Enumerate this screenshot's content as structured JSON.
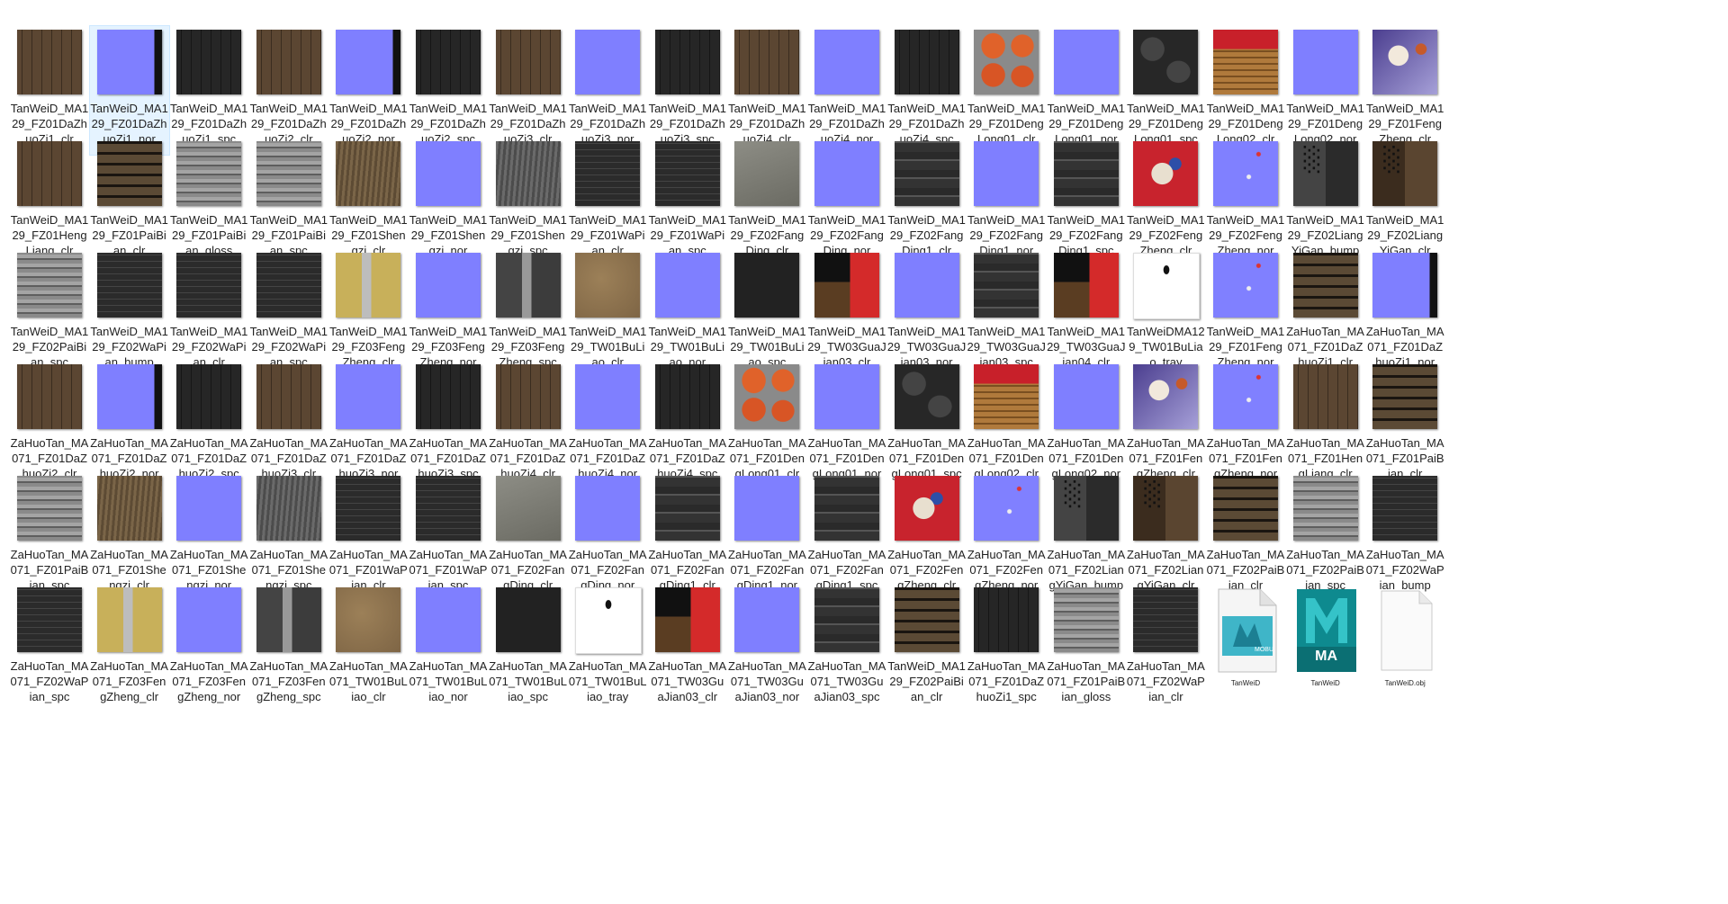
{
  "file_view": {
    "selected_index": 1,
    "accent_color": "#e5f3ff",
    "items": [
      {
        "name": "TanWeiD_MA129_FZ01DaZhuoZi1_clr",
        "thumb": "wood-brown",
        "icon": "texture-thumbnail"
      },
      {
        "name": "TanWeiD_MA129_FZ01DaZhuoZi1_nor",
        "thumb": "normal-panels",
        "icon": "texture-thumbnail"
      },
      {
        "name": "TanWeiD_MA129_FZ01DaZhuoZi1_spc",
        "thumb": "dark-wood",
        "icon": "texture-thumbnail"
      },
      {
        "name": "TanWeiD_MA129_FZ01DaZhuoZi2_clr",
        "thumb": "wood-brown",
        "icon": "texture-thumbnail"
      },
      {
        "name": "TanWeiD_MA129_FZ01DaZhuoZi2_nor",
        "thumb": "normal-panels",
        "icon": "texture-thumbnail"
      },
      {
        "name": "TanWeiD_MA129_FZ01DaZhuoZi2_spc",
        "thumb": "dark-wood",
        "icon": "texture-thumbnail"
      },
      {
        "name": "TanWeiD_MA129_FZ01DaZhuoZi3_clr",
        "thumb": "wood-brown",
        "icon": "texture-thumbnail"
      },
      {
        "name": "TanWeiD_MA129_FZ01DaZhuoZi3_nor",
        "thumb": "normal",
        "icon": "texture-thumbnail"
      },
      {
        "name": "TanWeiD_MA129_FZ01DaZhuoZi3_spc",
        "thumb": "dark-wood",
        "icon": "texture-thumbnail"
      },
      {
        "name": "TanWeiD_MA129_FZ01DaZhuoZi4_clr",
        "thumb": "wood-brown",
        "icon": "texture-thumbnail"
      },
      {
        "name": "TanWeiD_MA129_FZ01DaZhuoZi4_nor",
        "thumb": "normal",
        "icon": "texture-thumbnail"
      },
      {
        "name": "TanWeiD_MA129_FZ01DaZhuoZi4_spc",
        "thumb": "dark-wood",
        "icon": "texture-thumbnail"
      },
      {
        "name": "TanWeiD_MA129_FZ01DengLong01_clr",
        "thumb": "lantern-orange",
        "icon": "texture-thumbnail"
      },
      {
        "name": "TanWeiD_MA129_FZ01DengLong01_nor",
        "thumb": "normal",
        "icon": "texture-thumbnail"
      },
      {
        "name": "TanWeiD_MA129_FZ01DengLong01_spc",
        "thumb": "lantern-dark",
        "icon": "texture-thumbnail"
      },
      {
        "name": "TanWeiD_MA129_FZ01DengLong02_clr",
        "thumb": "lantern-red",
        "icon": "texture-thumbnail"
      },
      {
        "name": "TanWeiD_MA129_FZ01DengLong02_nor",
        "thumb": "normal",
        "icon": "texture-thumbnail"
      },
      {
        "name": "TanWeiD_MA129_FZ01FengZheng_clr",
        "thumb": "kite-blue",
        "icon": "texture-thumbnail"
      },
      {
        "name": "TanWeiD_MA129_FZ01HengLiang_clr",
        "thumb": "wood-brown",
        "icon": "texture-thumbnail"
      },
      {
        "name": "TanWeiD_MA129_FZ01PaiBian_clr",
        "thumb": "planks",
        "icon": "texture-thumbnail"
      },
      {
        "name": "TanWeiD_MA129_FZ01PaiBian_gloss",
        "thumb": "grey-wood",
        "icon": "texture-thumbnail"
      },
      {
        "name": "TanWeiD_MA129_FZ01PaiBian_spc",
        "thumb": "grey-wood",
        "icon": "texture-thumbnail"
      },
      {
        "name": "TanWeiD_MA129_FZ01Shengzi_clr",
        "thumb": "rope-brown",
        "icon": "texture-thumbnail"
      },
      {
        "name": "TanWeiD_MA129_FZ01Shengzi_nor",
        "thumb": "normal",
        "icon": "texture-thumbnail"
      },
      {
        "name": "TanWeiD_MA129_FZ01Shengzi_spc",
        "thumb": "rope-grey",
        "icon": "texture-thumbnail"
      },
      {
        "name": "TanWeiD_MA129_FZ01WaPian_clr",
        "thumb": "dark-grid",
        "icon": "texture-thumbnail"
      },
      {
        "name": "TanWeiD_MA129_FZ01WaPian_spc",
        "thumb": "dark-grid",
        "icon": "texture-thumbnail"
      },
      {
        "name": "TanWeiD_MA129_FZ02FangDing_clr",
        "thumb": "grey-roof",
        "icon": "texture-thumbnail"
      },
      {
        "name": "TanWeiD_MA129_FZ02FangDing_nor",
        "thumb": "normal",
        "icon": "texture-thumbnail"
      },
      {
        "name": "TanWeiD_MA129_FZ02FangDing1_clr",
        "thumb": "atlas-dark",
        "icon": "texture-thumbnail"
      },
      {
        "name": "TanWeiD_MA129_FZ02FangDing1_nor",
        "thumb": "normal",
        "icon": "texture-thumbnail"
      },
      {
        "name": "TanWeiD_MA129_FZ02FangDing1_spc",
        "thumb": "atlas-dark",
        "icon": "texture-thumbnail"
      },
      {
        "name": "TanWeiD_MA129_FZ02FengZheng_clr",
        "thumb": "kite-red",
        "icon": "texture-thumbnail"
      },
      {
        "name": "TanWeiD_MA129_FZ02FengZheng_nor",
        "thumb": "normal-spots",
        "icon": "texture-thumbnail"
      },
      {
        "name": "TanWeiD_MA129_FZ02LiangYiGan_bump",
        "thumb": "sign-grey",
        "icon": "texture-thumbnail"
      },
      {
        "name": "TanWeiD_MA129_FZ02LiangYiGan_clr",
        "thumb": "sign-brown",
        "icon": "texture-thumbnail"
      },
      {
        "name": "TanWeiD_MA129_FZ02PaiBian_spc",
        "thumb": "grey-wood",
        "icon": "texture-thumbnail"
      },
      {
        "name": "TanWeiD_MA129_FZ02WaPian_bump",
        "thumb": "dark-grid",
        "icon": "texture-thumbnail"
      },
      {
        "name": "TanWeiD_MA129_FZ02WaPian_clr",
        "thumb": "dark-grid",
        "icon": "texture-thumbnail"
      },
      {
        "name": "TanWeiD_MA129_FZ02WaPian_spc",
        "thumb": "dark-grid",
        "icon": "texture-thumbnail"
      },
      {
        "name": "TanWeiD_MA129_FZ03FengZheng_clr",
        "thumb": "yellow-split",
        "icon": "texture-thumbnail"
      },
      {
        "name": "TanWeiD_MA129_FZ03FengZheng_nor",
        "thumb": "normal",
        "icon": "texture-thumbnail"
      },
      {
        "name": "TanWeiD_MA129_FZ03FengZheng_spc",
        "thumb": "grey-split",
        "icon": "texture-thumbnail"
      },
      {
        "name": "TanWeiD_MA129_TW01BuLiao_clr",
        "thumb": "cloth-tan",
        "icon": "texture-thumbnail"
      },
      {
        "name": "TanWeiD_MA129_TW01BuLiao_nor",
        "thumb": "normal",
        "icon": "texture-thumbnail"
      },
      {
        "name": "TanWeiD_MA129_TW01BuLiao_spc",
        "thumb": "near-black",
        "icon": "texture-thumbnail"
      },
      {
        "name": "TanWeiD_MA129_TW03GuaJian03_clr",
        "thumb": "kite-atlas",
        "icon": "texture-thumbnail"
      },
      {
        "name": "TanWeiD_MA129_TW03GuaJian03_nor",
        "thumb": "normal",
        "icon": "texture-thumbnail"
      },
      {
        "name": "TanWeiD_MA129_TW03GuaJian03_spc",
        "thumb": "atlas-dark",
        "icon": "texture-thumbnail"
      },
      {
        "name": "TanWeiD_MA129_TW03GuaJian04_clr",
        "thumb": "kite-atlas",
        "icon": "texture-thumbnail"
      },
      {
        "name": "TanWeiDMA129_TW01BuLiao_tray",
        "thumb": "white-tray",
        "icon": "texture-thumbnail"
      },
      {
        "name": "TanWeiD_MA129_FZ01FengZheng_nor",
        "thumb": "normal-spots",
        "icon": "texture-thumbnail"
      },
      {
        "name": "ZaHuoTan_MA071_FZ01DaZhuoZi1_clr",
        "thumb": "planks",
        "icon": "texture-thumbnail"
      },
      {
        "name": "ZaHuoTan_MA071_FZ01DaZhuoZi1_nor",
        "thumb": "normal-panels",
        "icon": "texture-thumbnail"
      },
      {
        "name": "ZaHuoTan_MA071_FZ01DaZhuoZi2_clr",
        "thumb": "wood-brown",
        "icon": "texture-thumbnail"
      },
      {
        "name": "ZaHuoTan_MA071_FZ01DaZhuoZi2_nor",
        "thumb": "normal-panels",
        "icon": "texture-thumbnail"
      },
      {
        "name": "ZaHuoTan_MA071_FZ01DaZhuoZi2_spc",
        "thumb": "dark-wood",
        "icon": "texture-thumbnail"
      },
      {
        "name": "ZaHuoTan_MA071_FZ01DaZhuoZi3_clr",
        "thumb": "wood-brown",
        "icon": "texture-thumbnail"
      },
      {
        "name": "ZaHuoTan_MA071_FZ01DaZhuoZi3_nor",
        "thumb": "normal",
        "icon": "texture-thumbnail"
      },
      {
        "name": "ZaHuoTan_MA071_FZ01DaZhuoZi3_spc",
        "thumb": "dark-wood",
        "icon": "texture-thumbnail"
      },
      {
        "name": "ZaHuoTan_MA071_FZ01DaZhuoZi4_clr",
        "thumb": "wood-brown",
        "icon": "texture-thumbnail"
      },
      {
        "name": "ZaHuoTan_MA071_FZ01DaZhuoZi4_nor",
        "thumb": "normal",
        "icon": "texture-thumbnail"
      },
      {
        "name": "ZaHuoTan_MA071_FZ01DaZhuoZi4_spc",
        "thumb": "dark-wood",
        "icon": "texture-thumbnail"
      },
      {
        "name": "ZaHuoTan_MA071_FZ01DengLong01_clr",
        "thumb": "lantern-orange",
        "icon": "texture-thumbnail"
      },
      {
        "name": "ZaHuoTan_MA071_FZ01DengLong01_nor",
        "thumb": "normal",
        "icon": "texture-thumbnail"
      },
      {
        "name": "ZaHuoTan_MA071_FZ01DengLong01_spc",
        "thumb": "lantern-dark",
        "icon": "texture-thumbnail"
      },
      {
        "name": "ZaHuoTan_MA071_FZ01DengLong02_clr",
        "thumb": "lantern-red",
        "icon": "texture-thumbnail"
      },
      {
        "name": "ZaHuoTan_MA071_FZ01DengLong02_nor",
        "thumb": "normal",
        "icon": "texture-thumbnail"
      },
      {
        "name": "ZaHuoTan_MA071_FZ01FengZheng_clr",
        "thumb": "kite-blue",
        "icon": "texture-thumbnail"
      },
      {
        "name": "ZaHuoTan_MA071_FZ01FengZheng_nor",
        "thumb": "normal-spots",
        "icon": "texture-thumbnail"
      },
      {
        "name": "ZaHuoTan_MA071_FZ01HengLiang_clr",
        "thumb": "wood-brown",
        "icon": "texture-thumbnail"
      },
      {
        "name": "ZaHuoTan_MA071_FZ01PaiBian_clr",
        "thumb": "planks",
        "icon": "texture-thumbnail"
      },
      {
        "name": "ZaHuoTan_MA071_FZ01PaiBian_spc",
        "thumb": "grey-wood",
        "icon": "texture-thumbnail"
      },
      {
        "name": "ZaHuoTan_MA071_FZ01Shengzi_clr",
        "thumb": "rope-brown",
        "icon": "texture-thumbnail"
      },
      {
        "name": "ZaHuoTan_MA071_FZ01Shengzi_nor",
        "thumb": "normal",
        "icon": "texture-thumbnail"
      },
      {
        "name": "ZaHuoTan_MA071_FZ01Shengzi_spc",
        "thumb": "rope-grey",
        "icon": "texture-thumbnail"
      },
      {
        "name": "ZaHuoTan_MA071_FZ01WaPian_clr",
        "thumb": "dark-grid",
        "icon": "texture-thumbnail"
      },
      {
        "name": "ZaHuoTan_MA071_FZ01WaPian_spc",
        "thumb": "dark-grid",
        "icon": "texture-thumbnail"
      },
      {
        "name": "ZaHuoTan_MA071_FZ02FangDing_clr",
        "thumb": "grey-roof",
        "icon": "texture-thumbnail"
      },
      {
        "name": "ZaHuoTan_MA071_FZ02FangDing_nor",
        "thumb": "normal",
        "icon": "texture-thumbnail"
      },
      {
        "name": "ZaHuoTan_MA071_FZ02FangDing1_clr",
        "thumb": "atlas-dark",
        "icon": "texture-thumbnail"
      },
      {
        "name": "ZaHuoTan_MA071_FZ02FangDing1_nor",
        "thumb": "normal",
        "icon": "texture-thumbnail"
      },
      {
        "name": "ZaHuoTan_MA071_FZ02FangDing1_spc",
        "thumb": "atlas-dark",
        "icon": "texture-thumbnail"
      },
      {
        "name": "ZaHuoTan_MA071_FZ02FengZheng_clr",
        "thumb": "kite-red",
        "icon": "texture-thumbnail"
      },
      {
        "name": "ZaHuoTan_MA071_FZ02FengZheng_nor",
        "thumb": "normal-spots",
        "icon": "texture-thumbnail"
      },
      {
        "name": "ZaHuoTan_MA071_FZ02LiangYiGan_bump",
        "thumb": "sign-grey",
        "icon": "texture-thumbnail"
      },
      {
        "name": "ZaHuoTan_MA071_FZ02LiangYiGan_clr",
        "thumb": "sign-brown",
        "icon": "texture-thumbnail"
      },
      {
        "name": "ZaHuoTan_MA071_FZ02PaiBian_clr",
        "thumb": "planks",
        "icon": "texture-thumbnail"
      },
      {
        "name": "ZaHuoTan_MA071_FZ02PaiBian_spc",
        "thumb": "grey-wood",
        "icon": "texture-thumbnail"
      },
      {
        "name": "ZaHuoTan_MA071_FZ02WaPian_bump",
        "thumb": "dark-grid",
        "icon": "texture-thumbnail"
      },
      {
        "name": "ZaHuoTan_MA071_FZ02WaPian_spc",
        "thumb": "dark-grid",
        "icon": "texture-thumbnail"
      },
      {
        "name": "ZaHuoTan_MA071_FZ03FengZheng_clr",
        "thumb": "yellow-split",
        "icon": "texture-thumbnail"
      },
      {
        "name": "ZaHuoTan_MA071_FZ03FengZheng_nor",
        "thumb": "normal",
        "icon": "texture-thumbnail"
      },
      {
        "name": "ZaHuoTan_MA071_FZ03FengZheng_spc",
        "thumb": "grey-split",
        "icon": "texture-thumbnail"
      },
      {
        "name": "ZaHuoTan_MA071_TW01BuLiao_clr",
        "thumb": "cloth-tan",
        "icon": "texture-thumbnail"
      },
      {
        "name": "ZaHuoTan_MA071_TW01BuLiao_nor",
        "thumb": "normal",
        "icon": "texture-thumbnail"
      },
      {
        "name": "ZaHuoTan_MA071_TW01BuLiao_spc",
        "thumb": "near-black",
        "icon": "texture-thumbnail"
      },
      {
        "name": "ZaHuoTan_MA071_TW01BuLiao_tray",
        "thumb": "white-tray",
        "icon": "texture-thumbnail"
      },
      {
        "name": "ZaHuoTan_MA071_TW03GuaJian03_clr",
        "thumb": "kite-atlas",
        "icon": "texture-thumbnail"
      },
      {
        "name": "ZaHuoTan_MA071_TW03GuaJian03_nor",
        "thumb": "normal",
        "icon": "texture-thumbnail"
      },
      {
        "name": "ZaHuoTan_MA071_TW03GuaJian03_spc",
        "thumb": "atlas-dark",
        "icon": "texture-thumbnail"
      },
      {
        "name": "TanWeiD_MA129_FZ02PaiBian_clr",
        "thumb": "planks",
        "icon": "texture-thumbnail"
      },
      {
        "name": "ZaHuoTan_MA071_FZ01DaZhuoZi1_spc",
        "thumb": "dark-wood",
        "icon": "texture-thumbnail"
      },
      {
        "name": "ZaHuoTan_MA071_FZ01PaiBian_gloss",
        "thumb": "grey-wood",
        "icon": "texture-thumbnail"
      },
      {
        "name": "ZaHuoTan_MA071_FZ02WaPian_clr",
        "thumb": "dark-grid",
        "icon": "texture-thumbnail"
      },
      {
        "name": "TanWeiD",
        "thumb": "file-mobu",
        "icon": "motionbuilder-file-icon",
        "badge": "MOBU"
      },
      {
        "name": "TanWeiD",
        "thumb": "file-maya",
        "icon": "maya-file-icon",
        "badge": "MA"
      },
      {
        "name": "TanWeiD.obj",
        "thumb": "file-blank",
        "icon": "blank-file-icon"
      }
    ]
  }
}
